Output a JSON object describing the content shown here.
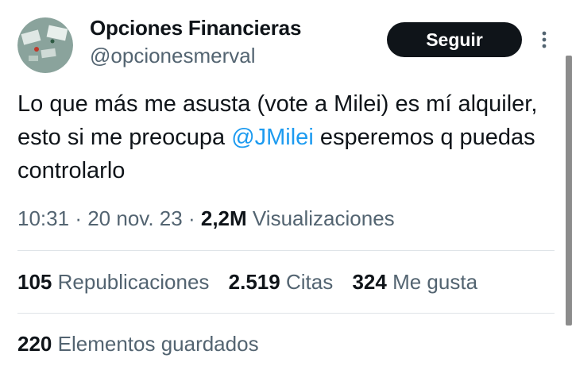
{
  "author": {
    "name": "Opciones Financieras",
    "handle": "@opcionesmerval"
  },
  "actions": {
    "follow_label": "Seguir"
  },
  "tweet": {
    "text_before_mention": "Lo que más me asusta (vote a Milei) es mí alquiler, esto si me preocupa ",
    "mention": "@JMilei",
    "text_after_mention": " esperemos q puedas controlarlo"
  },
  "meta": {
    "time": "10:31",
    "date": "20 nov. 23",
    "separator": "·",
    "views_count": "2,2M",
    "views_label": "Visualizaciones"
  },
  "stats": {
    "reposts_count": "105",
    "reposts_label": "Republicaciones",
    "quotes_count": "2.519",
    "quotes_label": "Citas",
    "likes_count": "324",
    "likes_label": "Me gusta",
    "bookmarks_count": "220",
    "bookmarks_label": "Elementos guardados"
  },
  "colors": {
    "accent": "#1d9bf0",
    "text": "#0f1419",
    "secondary": "#536471",
    "button_bg": "#0f1419"
  },
  "icons": {
    "more": "more-vertical-icon"
  }
}
